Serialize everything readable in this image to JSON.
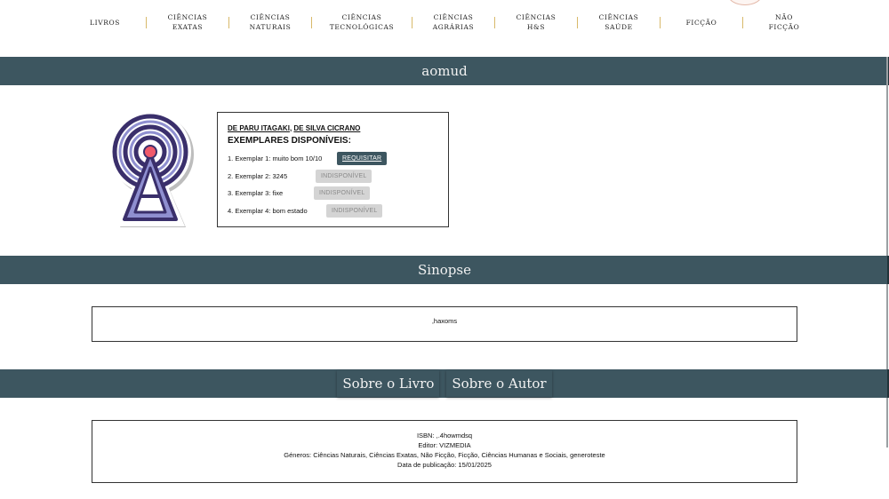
{
  "nav": {
    "items": [
      {
        "line1": "LIVROS",
        "line2": ""
      },
      {
        "line1": "CIÊNCIAS",
        "line2": "EXATAS"
      },
      {
        "line1": "CIÊNCIAS",
        "line2": "NATURAIS"
      },
      {
        "line1": "CIÊNCIAS",
        "line2": "TECNOLÓGICAS"
      },
      {
        "line1": "CIÊNCIAS",
        "line2": "AGRÁRIAS"
      },
      {
        "line1": "CIÊNCIAS",
        "line2": "H&S"
      },
      {
        "line1": "CIÊNCIAS",
        "line2": "SAÚDE"
      },
      {
        "line1": "FICÇÃO",
        "line2": ""
      },
      {
        "line1": "NÃO",
        "line2": "FICÇÃO"
      }
    ]
  },
  "book": {
    "title": "aomud",
    "authors": [
      "DE PARU ITAGAKI",
      "DE SILVA CICRANO"
    ],
    "author_separator": ", ",
    "copies_heading": "EXEMPLARES DISPONÍVEIS:",
    "copies": [
      {
        "label": "1. Exemplar 1: muito bom 10/10",
        "action": "REQUISITAR",
        "available": true
      },
      {
        "label": "2. Exemplar 2: 3245",
        "action": "INDISPONÍVEL",
        "available": false
      },
      {
        "label": "3. Exemplar 3: fixe",
        "action": "INDISPONÍVEL",
        "available": false
      },
      {
        "label": "4. Exemplar 4: bom estado",
        "action": "INDISPONÍVEL",
        "available": false
      }
    ]
  },
  "synopsis": {
    "heading": "Sinopse",
    "text": ",haxoms"
  },
  "tabs": {
    "about_book": "Sobre o Livro",
    "about_author": "Sobre o Autor"
  },
  "info": {
    "isbn": "ISBN: ,.4howmdsq",
    "editor": "Editor: VIZMEDIA",
    "genres": "Géneros: Ciências Naturais, Ciências Exatas, Não Ficção, Ficção, Ciências Humanas e Sociais, generoteste",
    "date": "Data de publicação: 15/01/2025"
  },
  "colors": {
    "band": "#3d5660",
    "separator": "#d8b96a",
    "icon_purple": "#3a2f6b",
    "icon_lavender": "#8f8fd0",
    "icon_red": "#f05a6a"
  },
  "icons": {
    "cover": "radio-tower-icon"
  }
}
